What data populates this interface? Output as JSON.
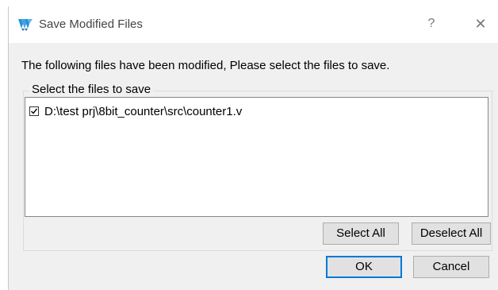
{
  "window": {
    "title": "Save Modified Files",
    "help_glyph": "?",
    "close_glyph": "✕",
    "icon": "app-logo-icon"
  },
  "instruction": "The following files have been modified, Please select the files to save.",
  "group": {
    "legend": "Select the files to save",
    "files": [
      {
        "path": "D:\\test prj\\8bit_counter\\src\\counter1.v",
        "checked": true
      }
    ]
  },
  "buttons": {
    "select_all": "Select All",
    "deselect_all": "Deselect All",
    "ok": "OK",
    "cancel": "Cancel"
  },
  "colors": {
    "dialog_bg": "#f0f0f0",
    "accent": "#0078d7",
    "logo": "#2a8fd6"
  }
}
